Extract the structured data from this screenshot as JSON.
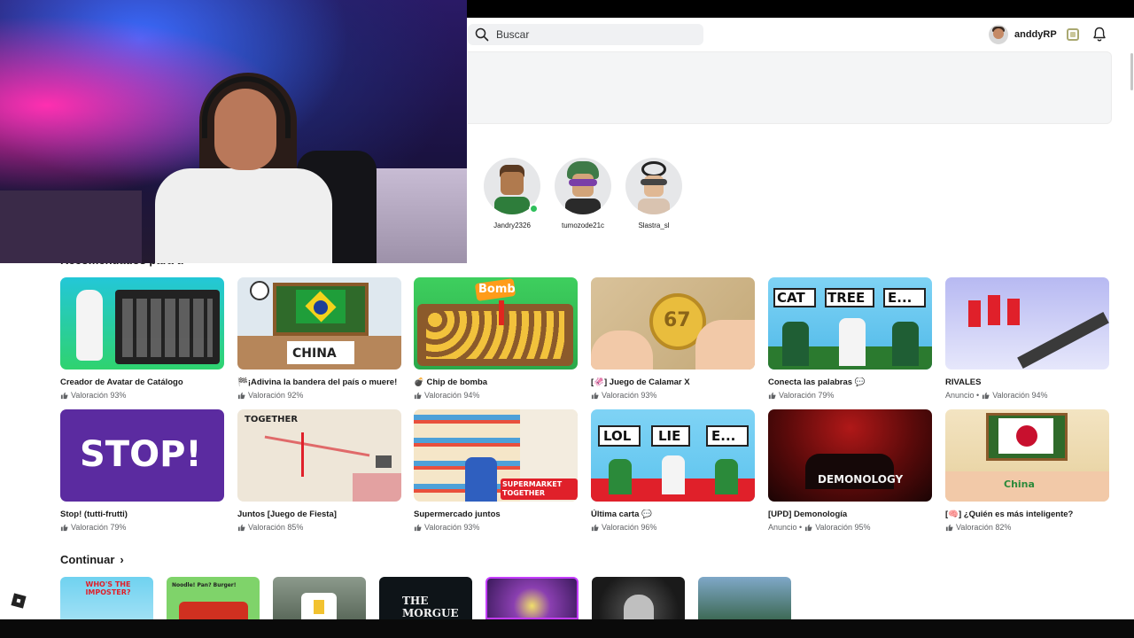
{
  "header": {
    "search_placeholder": "Buscar",
    "username": "anddyRP"
  },
  "friends": [
    {
      "name": "Jandry2326",
      "online": true
    },
    {
      "name": "tumozode21c",
      "online": false
    },
    {
      "name": "Slastra_sl",
      "online": false
    }
  ],
  "recommended": {
    "title": "Recomendados para ti"
  },
  "games": [
    {
      "title": "Creador de Avatar de Catálogo",
      "rating": "Valoración 93%",
      "ad": false
    },
    {
      "title": "🏁¡Adivina la bandera del país o muere!",
      "rating": "Valoración 92%",
      "ad": false
    },
    {
      "title": "💣 Chip de bomba",
      "rating": "Valoración 94%",
      "ad": false
    },
    {
      "title": "[🦑] Juego de Calamar X",
      "rating": "Valoración 93%",
      "ad": false
    },
    {
      "title": "Conecta las palabras 💬",
      "rating": "Valoración 79%",
      "ad": false
    },
    {
      "title": "RIVALES",
      "rating": "Valoración 94%",
      "ad": true,
      "ad_label": "Anuncio •"
    },
    {
      "title": "Stop! (tutti-frutti)",
      "rating": "Valoración 79%",
      "ad": false
    },
    {
      "title": "Juntos [Juego de Fiesta]",
      "rating": "Valoración 85%",
      "ad": false
    },
    {
      "title": "Supermercado juntos",
      "rating": "Valoración 93%",
      "ad": false
    },
    {
      "title": "Última carta 💬",
      "rating": "Valoración 96%",
      "ad": false
    },
    {
      "title": "[UPD] Demonología",
      "rating": "Valoración 95%",
      "ad": true,
      "ad_label": "Anuncio •"
    },
    {
      "title": "[🧠] ¿Quién es más inteligente?",
      "rating": "Valoración 82%",
      "ad": false
    }
  ],
  "thumb_text": {
    "bomb": "Bomb",
    "china": "CHINA",
    "num67": "67",
    "cat": "CAT",
    "tree": "TREE",
    "e_dots": "E...",
    "stop": "STOP!",
    "together": "TOGETHER",
    "supermarket": "SUPERMARKET TOGETHER",
    "lol": "LOL",
    "lie": "LIE",
    "demonology": "DEMONOLOGY",
    "china2": "China"
  },
  "continue": {
    "title": "Continuar",
    "thumb_texts": [
      "WHO'S THE IMPOSTER?",
      "Noodle! Pan? Burger!",
      "",
      "THE MORGUE",
      "",
      "",
      ""
    ]
  },
  "colors": {
    "online": "#2fbf5b",
    "text_primary": "#1a1a1a",
    "text_secondary": "#606265"
  }
}
